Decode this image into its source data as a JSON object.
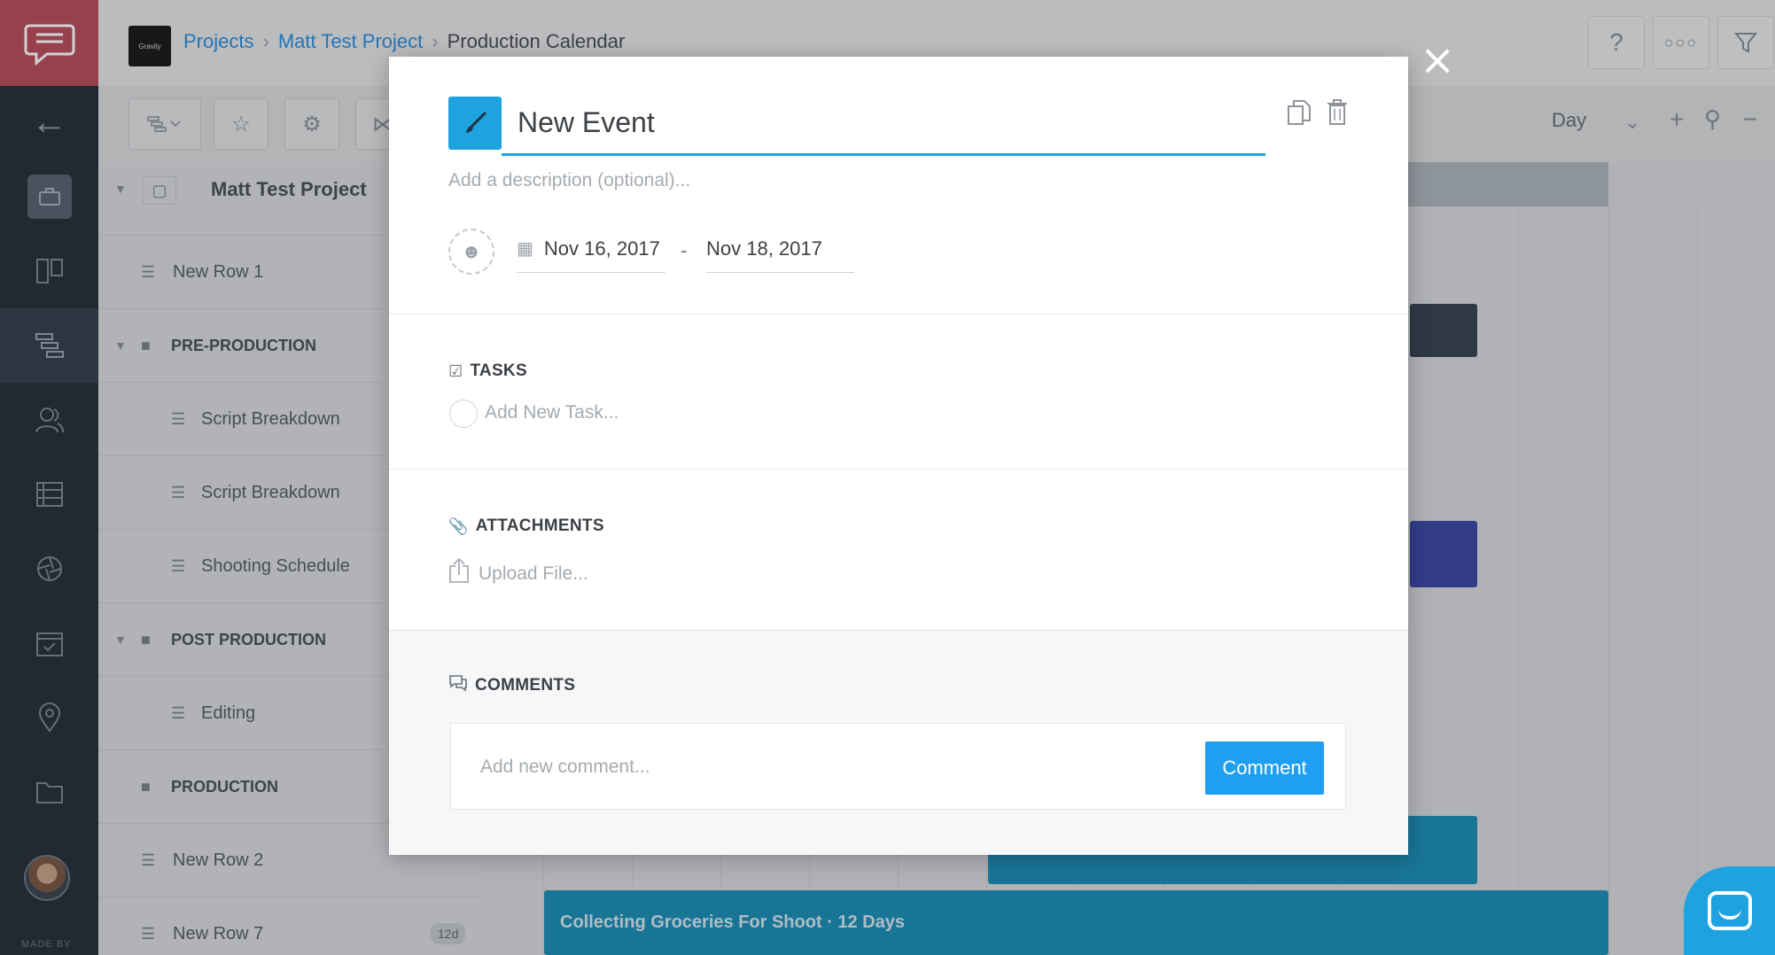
{
  "breadcrumb": {
    "projects": "Projects",
    "project": "Matt Test Project",
    "current": "Production Calendar",
    "project_logo_text": "Gravity"
  },
  "topbar": {
    "help_icon": "question-icon",
    "more_icon": "more-icon",
    "filter_icon": "filter-icon"
  },
  "toolbar": {
    "zoom_label": "Day"
  },
  "rail": {
    "made_by": "MADE BY"
  },
  "rows": [
    {
      "label": "Matt Test Project",
      "type": "project"
    },
    {
      "label": "New Row 1",
      "type": "row"
    },
    {
      "label": "PRE-PRODUCTION",
      "type": "group"
    },
    {
      "label": "Script Breakdown",
      "type": "child"
    },
    {
      "label": "Script Breakdown",
      "type": "child"
    },
    {
      "label": "Shooting Schedule",
      "type": "child"
    },
    {
      "label": "POST PRODUCTION",
      "type": "group"
    },
    {
      "label": "Editing",
      "type": "child"
    },
    {
      "label": "PRODUCTION",
      "type": "group"
    },
    {
      "label": "New Row 2",
      "type": "row"
    },
    {
      "label": "New Row 7",
      "type": "row",
      "badge": "12d"
    }
  ],
  "gantt": {
    "bottom_bar_label": "Collecting Groceries For Shoot · 12 Days"
  },
  "modal": {
    "title": "New Event",
    "description_placeholder": "Add a description (optional)...",
    "start_date": "Nov 16, 2017",
    "date_separator": "-",
    "end_date": "Nov 18, 2017",
    "tasks_title": "TASKS",
    "task_placeholder": "Add New Task...",
    "attachments_title": "ATTACHMENTS",
    "upload_label": "Upload File...",
    "comments_title": "COMMENTS",
    "comment_placeholder": "Add new comment...",
    "comment_button": "Comment",
    "swatch_color": "#1fa3e0"
  }
}
